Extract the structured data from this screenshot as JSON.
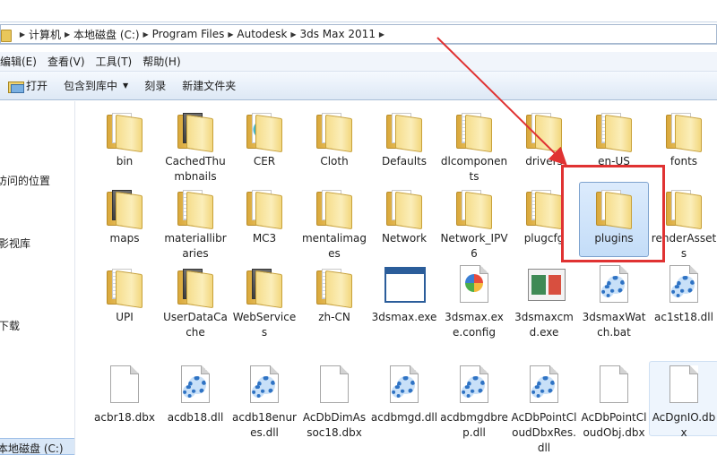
{
  "breadcrumb": [
    "计算机",
    "本地磁盘 (C:)",
    "Program Files",
    "Autodesk",
    "3ds Max 2011"
  ],
  "menu": [
    "编辑(E)",
    "查看(V)",
    "工具(T)",
    "帮助(H)"
  ],
  "toolbar": {
    "open": "打开",
    "include_library": "包含到库中",
    "burn": "刻录",
    "new_folder": "新建文件夹"
  },
  "nav": {
    "recent": "访问的位置",
    "videos": "影视库",
    "downloads": "下载",
    "drive": "本地磁盘 (C:)"
  },
  "files": [
    {
      "name": "bin",
      "kind": "folder",
      "paper": "plain"
    },
    {
      "name": "CachedThumbnails",
      "kind": "folder",
      "paper": "dark"
    },
    {
      "name": "CER",
      "kind": "folder",
      "paper": "blue"
    },
    {
      "name": "Cloth",
      "kind": "folder",
      "paper": "plain"
    },
    {
      "name": "Defaults",
      "kind": "folder",
      "paper": "plain"
    },
    {
      "name": "dlcomponents",
      "kind": "folder",
      "paper": "lines"
    },
    {
      "name": "drivers",
      "kind": "folder",
      "paper": "plain"
    },
    {
      "name": "en-US",
      "kind": "folder",
      "paper": "lines"
    },
    {
      "name": "fonts",
      "kind": "folder",
      "paper": "plain"
    },
    {
      "name": "maps",
      "kind": "folder",
      "paper": "dark"
    },
    {
      "name": "materiallibraries",
      "kind": "folder",
      "paper": "lines"
    },
    {
      "name": "MC3",
      "kind": "folder",
      "paper": "plain"
    },
    {
      "name": "mentalimages",
      "kind": "folder",
      "paper": "plain"
    },
    {
      "name": "Network",
      "kind": "folder",
      "paper": "plain"
    },
    {
      "name": "Network_IPV6",
      "kind": "folder",
      "paper": "plain"
    },
    {
      "name": "plugcfg",
      "kind": "folder",
      "paper": "lines"
    },
    {
      "name": "plugins",
      "kind": "folder",
      "paper": "plain",
      "selected": true
    },
    {
      "name": "renderAssets",
      "kind": "folder",
      "paper": "plain"
    },
    {
      "name": "UPI",
      "kind": "folder",
      "paper": "lines"
    },
    {
      "name": "UserDataCache",
      "kind": "folder",
      "paper": "dark"
    },
    {
      "name": "WebServices",
      "kind": "folder",
      "paper": "dark"
    },
    {
      "name": "zh-CN",
      "kind": "folder",
      "paper": "lines"
    },
    {
      "name": "3dsmax.exe",
      "kind": "window"
    },
    {
      "name": "3dsmax.exe.config",
      "kind": "config"
    },
    {
      "name": "3dsmaxcmd.exe",
      "kind": "cmd"
    },
    {
      "name": "3dsmaxWatch.bat",
      "kind": "gear"
    },
    {
      "name": "ac1st18.dll",
      "kind": "gear"
    },
    {
      "name": "acbr18.dbx",
      "kind": "doc"
    },
    {
      "name": "acdb18.dll",
      "kind": "gear"
    },
    {
      "name": "acdb18enures.dll",
      "kind": "gear"
    },
    {
      "name": "AcDbDimAssoc18.dbx",
      "kind": "doc"
    },
    {
      "name": "acdbmgd.dll",
      "kind": "gear"
    },
    {
      "name": "acdbmgdbrep.dll",
      "kind": "gear"
    },
    {
      "name": "AcDbPointCloudDbxRes.dll",
      "kind": "gear"
    },
    {
      "name": "AcDbPointCloudObj.dbx",
      "kind": "doc"
    },
    {
      "name": "AcDgnIO.dbx",
      "kind": "doc",
      "hover": true
    }
  ],
  "annotation_color": "#e03232"
}
